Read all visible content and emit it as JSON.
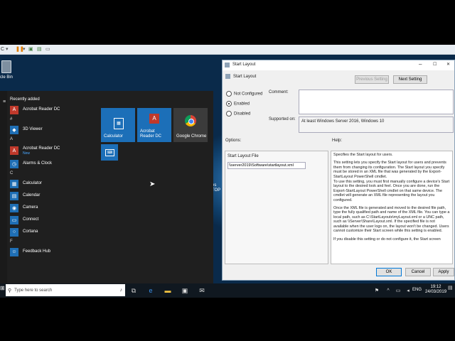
{
  "vm_toolbar": {
    "left_text": "C",
    "icons": [
      "pause-icon",
      "play-icon",
      "snapshot-icon",
      "revert-icon"
    ]
  },
  "desktop": {
    "recycle_bin": "cle Bin",
    "partial_text": [
      "es",
      "TOP"
    ]
  },
  "start_menu": {
    "sections": [
      {
        "header": "Recently added",
        "items": [
          {
            "label": "Acrobat Reader DC",
            "icon": "acrobat-icon",
            "color": "#c0392b"
          }
        ]
      },
      {
        "header": "#",
        "items": [
          {
            "label": "3D Viewer",
            "icon": "cube-icon",
            "color": "#1f6fb5"
          }
        ]
      },
      {
        "header": "A",
        "items": [
          {
            "label": "Acrobat Reader DC",
            "sub": "New",
            "icon": "acrobat-icon",
            "color": "#c0392b"
          },
          {
            "label": "Alarms & Clock",
            "icon": "alarm-clock-icon",
            "color": "#1f6fb5"
          }
        ]
      },
      {
        "header": "C",
        "items": [
          {
            "label": "Calculator",
            "icon": "calculator-icon",
            "color": "#1f6fb5"
          },
          {
            "label": "Calendar",
            "icon": "calendar-icon",
            "color": "#1f6fb5"
          },
          {
            "label": "Camera",
            "icon": "camera-icon",
            "color": "#1f6fb5"
          },
          {
            "label": "Connect",
            "icon": "connect-icon",
            "color": "#1f6fb5"
          },
          {
            "label": "Cortana",
            "icon": "cortana-icon",
            "color": "#1f6fb5"
          }
        ]
      },
      {
        "header": "F",
        "items": [
          {
            "label": "Feedback Hub",
            "icon": "feedback-icon",
            "color": "#1f6fb5"
          }
        ]
      }
    ],
    "tiles": [
      {
        "label": "Calculator",
        "icon": "calculator-icon"
      },
      {
        "label": "Acrobat Reader DC",
        "icon": "acrobat-icon"
      },
      {
        "label": "Google Chrome",
        "icon": "chrome-icon"
      },
      {
        "label": "",
        "icon": "keyboard-icon"
      }
    ]
  },
  "dialog": {
    "title": "Start Layout",
    "setting_name": "Start Layout",
    "prev_button": "Previous Setting",
    "next_button": "Next Setting",
    "radio_not_configured": "Not Configured",
    "radio_enabled": "Enabled",
    "radio_disabled": "Disabled",
    "comment_label": "Comment:",
    "supported_label": "Supported on:",
    "supported_value": "At least Windows Server 2016, Windows 10",
    "options_label": "Options:",
    "help_label": "Help:",
    "file_label": "Start Layout File",
    "file_value": "\\\\server2019\\Software\\startlayout.xml",
    "help_paragraphs": [
      "Specifies the Start layout for users.",
      "This setting lets you specify the Start layout for users and prevents them from changing its configuration. The Start layout you specify must be stored in an XML file that was generated by the Export-StartLayout PowerShell cmdlet.",
      "To use this setting, you must first manually configure a device's Start layout to the desired look and feel. Once you are done, run the Export-StartLayout PowerShell cmdlet on that same device. The cmdlet will generate an XML file representing the layout you configured.",
      "Once the XML file is generated and moved to the desired file path, type the fully qualified path and name of the XML file. You can type a local path, such as C:\\StartLayouts\\myLayout.xml or a UNC path, such as \\\\Server\\Share\\Layout.xml. If the specified file is not available when the user logs on, the layout won't be changed. Users cannot customize their Start screen while this setting is enabled.",
      "If you disable this setting or do not configure it, the Start screen"
    ],
    "ok_button": "OK",
    "cancel_button": "Cancel",
    "apply_button": "Apply"
  },
  "taskbar": {
    "search_placeholder": "Type here to search",
    "lang": "ENG",
    "time": "19:12",
    "date": "24/03/2019"
  }
}
